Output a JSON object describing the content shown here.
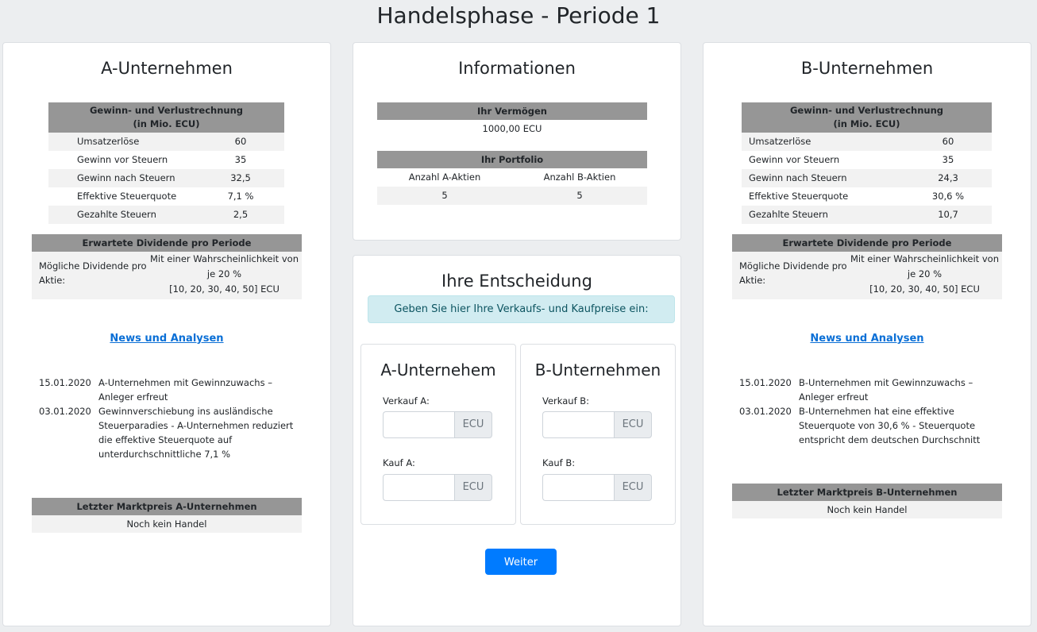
{
  "page": {
    "title": "Handelsphase - Periode 1"
  },
  "companyA": {
    "title": "A-Unternehmen",
    "pl_header_line1": "Gewinn- und Verlustrechnung",
    "pl_header_line2": "(in Mio. ECU)",
    "rows": [
      {
        "label": "Umsatzerlöse",
        "value": "60"
      },
      {
        "label": "Gewinn vor Steuern",
        "value": "35"
      },
      {
        "label": "Gewinn nach Steuern",
        "value": "32,5"
      },
      {
        "label": "Effektive Steuerquote",
        "value": "7,1 %"
      },
      {
        "label": "Gezahlte Steuern",
        "value": "2,5"
      }
    ],
    "div_header": "Erwartete Dividende pro Periode",
    "div_label": "Mögliche Dividende pro Aktie:",
    "div_line1": "Mit einer Wahrscheinlichkeit von je 20 %",
    "div_line2": "[10, 20, 30, 40, 50] ECU",
    "news_link": "News und Analysen",
    "news": [
      {
        "date": "15.01.2020",
        "text": "A-Unternehmen mit Gewinnzuwachs – Anleger erfreut"
      },
      {
        "date": "03.01.2020",
        "text": "Gewinnverschiebung ins ausländische Steuerparadies - A-Unternehmen reduziert die effektive Steuerquote auf unterdurchschnittliche 7,1 %"
      }
    ],
    "price_header": "Letzter Marktpreis A-Unternehmen",
    "price_value": "Noch kein Handel"
  },
  "companyB": {
    "title": "B-Unternehmen",
    "pl_header_line1": "Gewinn- und Verlustrechnung",
    "pl_header_line2": "(in Mio. ECU)",
    "rows": [
      {
        "label": "Umsatzerlöse",
        "value": "60"
      },
      {
        "label": "Gewinn vor Steuern",
        "value": "35"
      },
      {
        "label": "Gewinn nach Steuern",
        "value": "24,3"
      },
      {
        "label": "Effektive Steuerquote",
        "value": "30,6 %"
      },
      {
        "label": "Gezahlte Steuern",
        "value": "10,7"
      }
    ],
    "div_header": "Erwartete Dividende pro Periode",
    "div_label": "Mögliche Dividende pro Aktie:",
    "div_line1": "Mit einer Wahrscheinlichkeit von je 20 %",
    "div_line2": "[10, 20, 30, 40, 50] ECU",
    "news_link": "News und Analysen",
    "news": [
      {
        "date": "15.01.2020",
        "text": "B-Unternehmen mit Gewinnzuwachs – Anleger erfreut"
      },
      {
        "date": "03.01.2020",
        "text": "B-Unternehmen hat eine effektive Steuerquote von 30,6 % - Steuerquote entspricht dem deutschen Durchschnitt"
      }
    ],
    "price_header": "Letzter Marktpreis B-Unternehmen",
    "price_value": "Noch kein Handel"
  },
  "info": {
    "title": "Informationen",
    "wealth_header": "Ihr Vermögen",
    "wealth_value": "1000,00 ECU",
    "portfolio_header": "Ihr Portfolio",
    "col_a": "Anzahl A-Aktien",
    "col_b": "Anzahl B-Aktien",
    "val_a": "5",
    "val_b": "5"
  },
  "decision": {
    "title": "Ihre Entscheidung",
    "hint": "Geben Sie hier Ihre Verkaufs- und Kaufpreise ein:",
    "a": {
      "title": "A-Unternehem",
      "sell_label": "Verkauf A:",
      "buy_label": "Kauf A:",
      "unit": "ECU"
    },
    "b": {
      "title": "B-Unternehmen",
      "sell_label": "Verkauf B:",
      "buy_label": "Kauf B:",
      "unit": "ECU"
    },
    "button": "Weiter"
  },
  "colors": {
    "button": "#007bff",
    "header_gray": "#969696",
    "info_bg": "#d1ecf1",
    "link": "#0a6fd6"
  }
}
